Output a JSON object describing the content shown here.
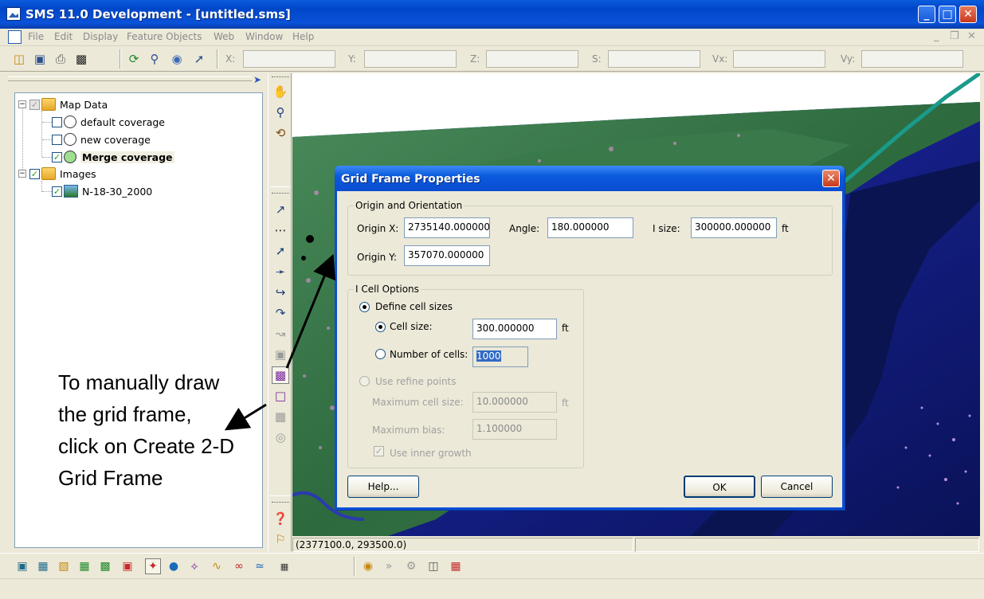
{
  "window": {
    "title": "SMS 11.0 Development - [untitled.sms]",
    "minimize": "_",
    "maximize": "□",
    "close": "✕"
  },
  "menu": {
    "items": [
      "File",
      "Edit",
      "Display",
      "Feature Objects",
      "Web",
      "Window",
      "Help"
    ],
    "mdi_min": "_",
    "mdi_restore": "❐",
    "mdi_close": "✕"
  },
  "toolbar": {
    "coords": [
      {
        "label": "X:"
      },
      {
        "label": "Y:"
      },
      {
        "label": "Z:"
      },
      {
        "label": "S:"
      },
      {
        "label": "Vx:"
      },
      {
        "label": "Vy:"
      }
    ]
  },
  "tree": {
    "map_data": "Map Data",
    "coverages": [
      "default coverage",
      "new coverage",
      "Merge coverage"
    ],
    "images": "Images",
    "image_item": "N-18-30_2000"
  },
  "status": {
    "coords": "(2377100.0, 293500.0)"
  },
  "dialog": {
    "title": "Grid Frame Properties",
    "close": "✕",
    "origin_group": "Origin and Orientation",
    "origin_x_label": "Origin X:",
    "origin_x": "2735140.000000",
    "angle_label": "Angle:",
    "angle": "180.000000",
    "isize_label": "I size:",
    "isize": "300000.000000",
    "isize_unit": "ft",
    "origin_y_label": "Origin Y:",
    "origin_y": "357070.000000",
    "cell_group": "I Cell Options",
    "define_cells": "Define cell sizes",
    "cell_size_label": "Cell size:",
    "cell_size": "300.000000",
    "cell_size_unit": "ft",
    "num_cells_label": "Number of cells:",
    "num_cells": "1000",
    "refine_points": "Use refine points",
    "max_cell_label": "Maximum cell size:",
    "max_cell": "10.000000",
    "max_cell_unit": "ft",
    "max_bias_label": "Maximum bias:",
    "max_bias": "1.100000",
    "inner_growth": "Use inner growth",
    "help_btn": "Help...",
    "ok_btn": "OK",
    "cancel_btn": "Cancel"
  },
  "annotation": {
    "line1": "To manually draw",
    "line2": "the grid frame,",
    "line3": "click on Create 2-D",
    "line4": "Grid Frame"
  },
  "colors": {
    "title_blue": "#0a52d8",
    "tree_border": "#7f9db9",
    "ocean": "#0b1a6e",
    "land": "#2f7a48",
    "arc": "#1a9a8a"
  }
}
